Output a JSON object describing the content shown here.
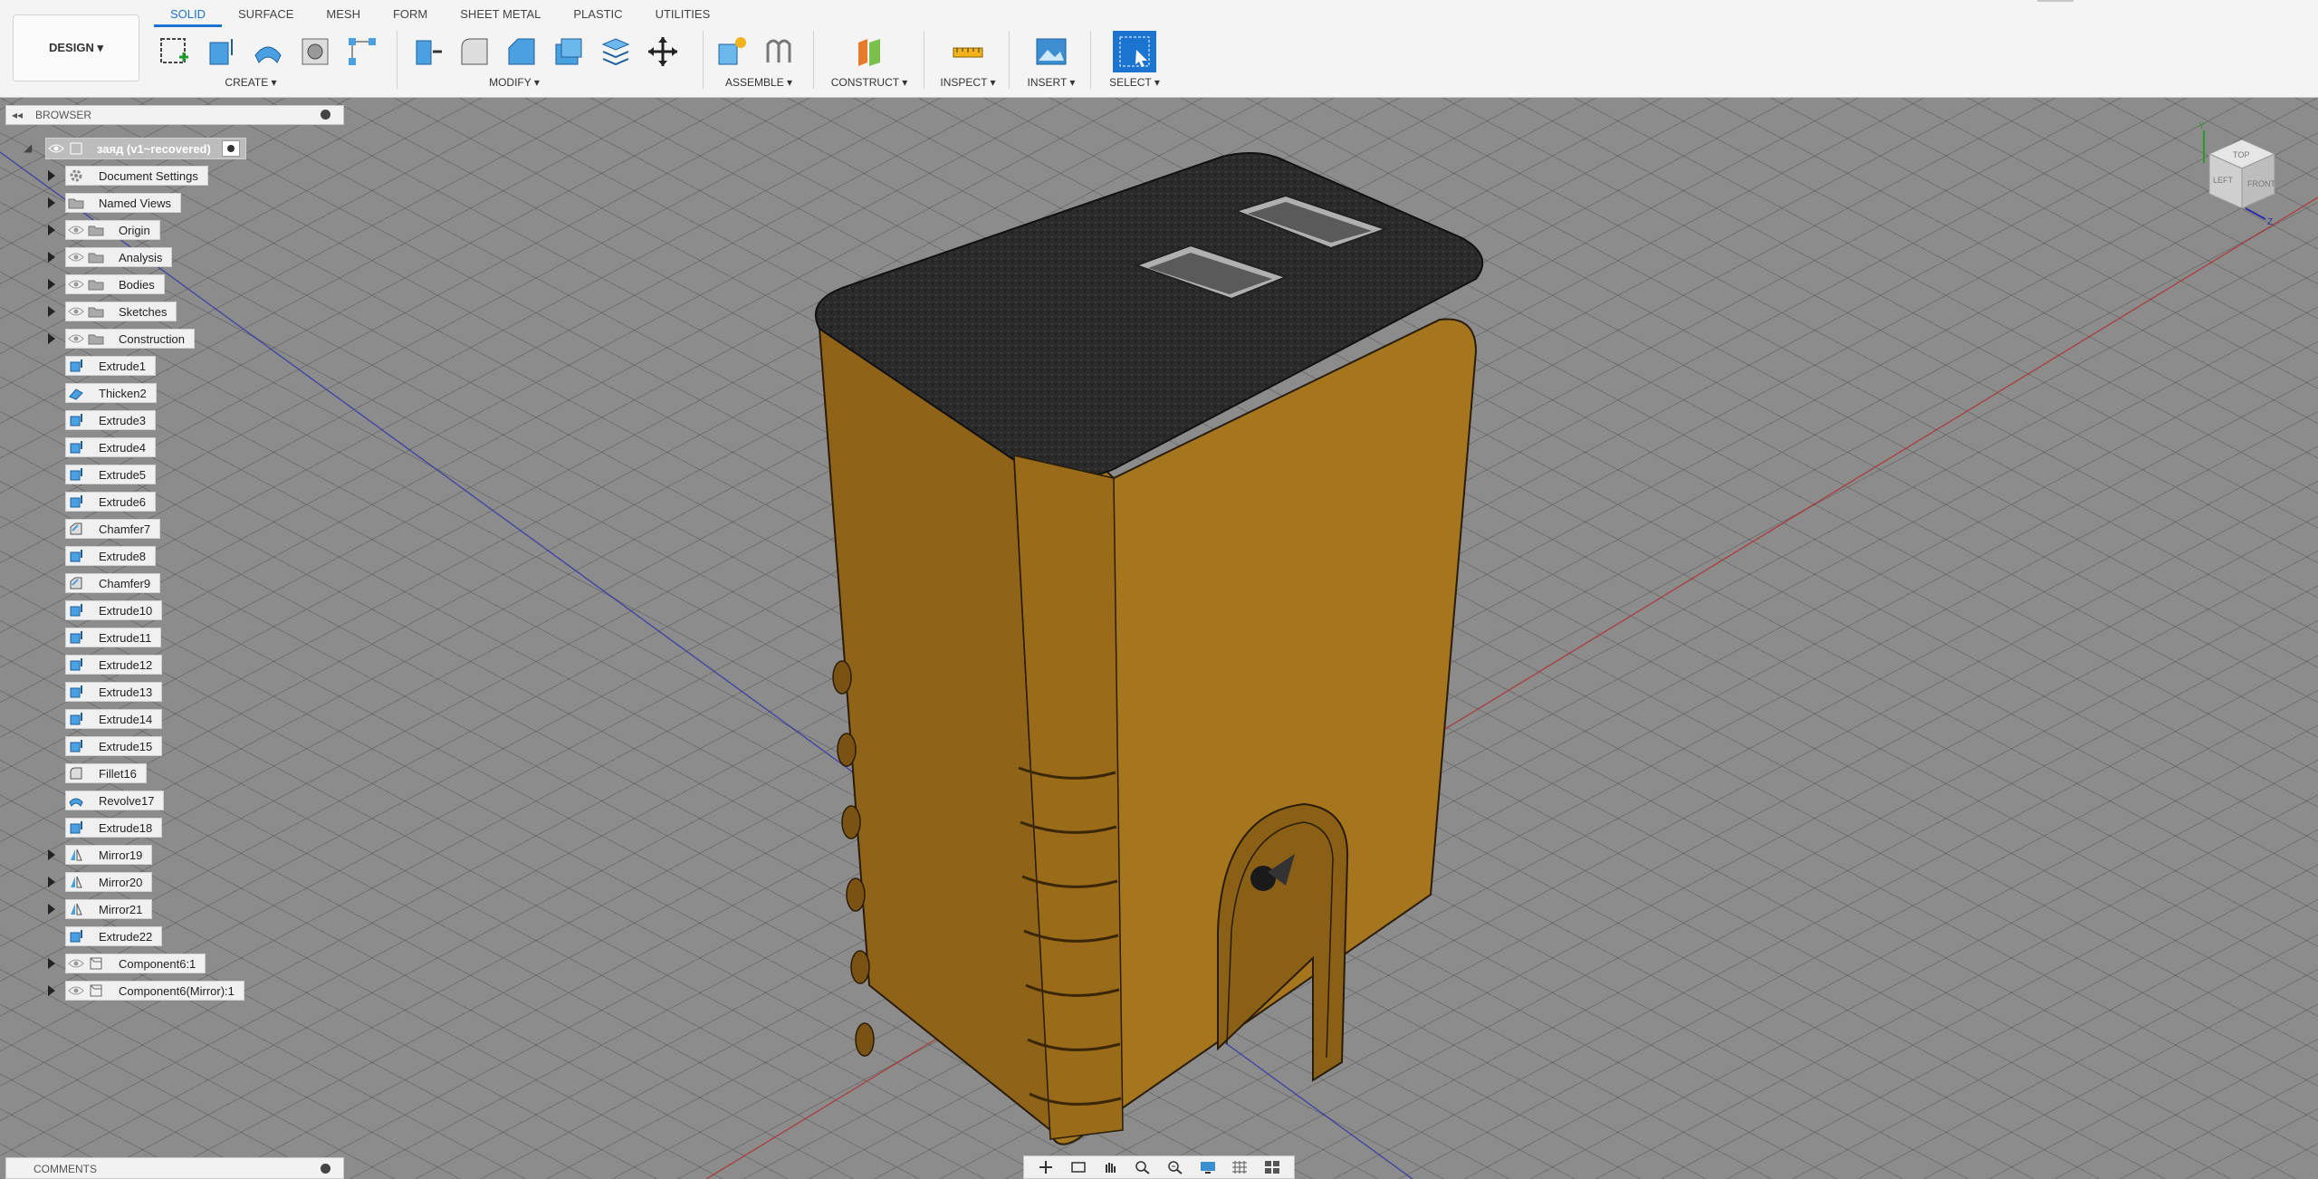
{
  "workspace": {
    "label": "DESIGN ▾"
  },
  "tabs": [
    {
      "label": "SOLID",
      "active": true
    },
    {
      "label": "SURFACE"
    },
    {
      "label": "MESH"
    },
    {
      "label": "FORM"
    },
    {
      "label": "SHEET METAL"
    },
    {
      "label": "PLASTIC"
    },
    {
      "label": "UTILITIES"
    }
  ],
  "toolbar_groups": {
    "create": "CREATE ▾",
    "modify": "MODIFY ▾",
    "assemble": "ASSEMBLE ▾",
    "construct": "CONSTRUCT ▾",
    "inspect": "INSPECT ▾",
    "insert": "INSERT ▾",
    "select": "SELECT ▾"
  },
  "browser": {
    "title": "BROWSER",
    "root": "заяд (v1~recovered)",
    "items": [
      {
        "label": "Document Settings",
        "icon": "gear-icon"
      },
      {
        "label": "Named Views",
        "icon": "folder-icon"
      },
      {
        "label": "Origin",
        "icon": "folder-icon"
      },
      {
        "label": "Analysis",
        "icon": "folder-icon"
      },
      {
        "label": "Bodies",
        "icon": "folder-icon"
      },
      {
        "label": "Sketches",
        "icon": "folder-icon"
      },
      {
        "label": "Construction",
        "icon": "folder-icon"
      },
      {
        "label": "Extrude1",
        "icon": "extrude-icon"
      },
      {
        "label": "Thicken2",
        "icon": "thicken-icon"
      },
      {
        "label": "Extrude3",
        "icon": "extrude-icon"
      },
      {
        "label": "Extrude4",
        "icon": "extrude-icon"
      },
      {
        "label": "Extrude5",
        "icon": "extrude-icon"
      },
      {
        "label": "Extrude6",
        "icon": "extrude-icon"
      },
      {
        "label": "Chamfer7",
        "icon": "chamfer-icon"
      },
      {
        "label": "Extrude8",
        "icon": "extrude-icon"
      },
      {
        "label": "Chamfer9",
        "icon": "chamfer-icon"
      },
      {
        "label": "Extrude10",
        "icon": "extrude-icon"
      },
      {
        "label": "Extrude11",
        "icon": "extrude-icon"
      },
      {
        "label": "Extrude12",
        "icon": "extrude-icon"
      },
      {
        "label": "Extrude13",
        "icon": "extrude-icon"
      },
      {
        "label": "Extrude14",
        "icon": "extrude-icon"
      },
      {
        "label": "Extrude15",
        "icon": "extrude-icon"
      },
      {
        "label": "Fillet16",
        "icon": "fillet-icon"
      },
      {
        "label": "Revolve17",
        "icon": "revolve-icon"
      },
      {
        "label": "Extrude18",
        "icon": "extrude-icon"
      },
      {
        "label": "Mirror19",
        "icon": "mirror-icon"
      },
      {
        "label": "Mirror20",
        "icon": "mirror-icon"
      },
      {
        "label": "Mirror21",
        "icon": "mirror-icon"
      },
      {
        "label": "Extrude22",
        "icon": "extrude-icon"
      },
      {
        "label": "Component6:1",
        "icon": "component-icon"
      },
      {
        "label": "Component6(Mirror):1",
        "icon": "component-icon"
      }
    ]
  },
  "viewcube": {
    "top": "TOP",
    "left": "LEFT",
    "front": "FRONT",
    "axis_y": "Y",
    "axis_z": "Z"
  },
  "comments": {
    "title": "COMMENTS"
  },
  "colors": {
    "accent": "#1b75d0",
    "model_body": "#a6761e",
    "model_top": "#2b2b2b",
    "viewport_bg": "#8c8c8c"
  }
}
